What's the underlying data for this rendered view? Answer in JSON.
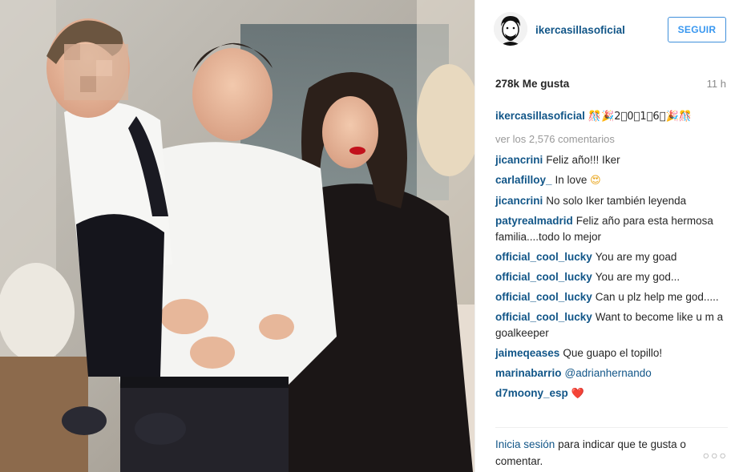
{
  "post": {
    "username": "ikercasillasoficial",
    "follow_label": "SEGUIR",
    "likes": "278k Me gusta",
    "time": "11 h",
    "caption_user": "ikercasillasoficial",
    "caption_text": "🎊🎉2⃣0⃣1⃣6⃣🎉🎊",
    "view_all": "ver los 2,576 comentarios"
  },
  "comments": [
    {
      "user": "jicancrini",
      "text": "Feliz año!!! Iker",
      "emoji": ""
    },
    {
      "user": "carlafilloy_",
      "text": "In love",
      "emoji": "😍"
    },
    {
      "user": "jicancrini",
      "text": "No solo Iker también leyenda",
      "emoji": ""
    },
    {
      "user": "patyrealmadrid",
      "text": "Feliz año para esta hermosa familia....todo lo mejor",
      "emoji": ""
    },
    {
      "user": "official_cool_lucky",
      "text": "You are my goad",
      "emoji": ""
    },
    {
      "user": "official_cool_lucky",
      "text": "You are my god...",
      "emoji": ""
    },
    {
      "user": "official_cool_lucky",
      "text": "Can u plz help me god.....",
      "emoji": ""
    },
    {
      "user": "official_cool_lucky",
      "text": "Want to become like u m a goalkeeper",
      "emoji": ""
    },
    {
      "user": "jaimeqeases",
      "text": "Que guapo el topillo!",
      "emoji": ""
    },
    {
      "user": "marinabarrio",
      "text": "@adrianhernando",
      "emoji": ""
    },
    {
      "user": "d7moony_esp",
      "text": "",
      "emoji": "❤️"
    }
  ],
  "footer": {
    "login_link": "Inicia sesión",
    "login_text": "para indicar que te gusta o comentar.",
    "more_label": "○○○"
  },
  "icons": {
    "more": "more-options-icon",
    "avatar": "profile-avatar"
  },
  "colors": {
    "link": "#125688",
    "follow": "#3897f0",
    "meta": "#999999",
    "heart": "#e0103a"
  }
}
